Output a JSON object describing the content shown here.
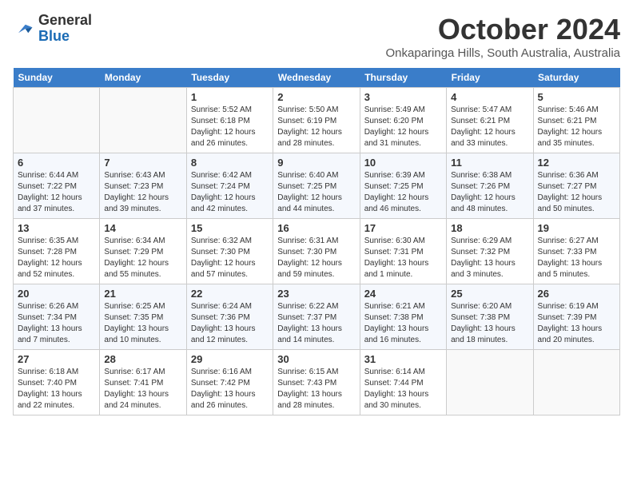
{
  "header": {
    "logo_general": "General",
    "logo_blue": "Blue",
    "month": "October 2024",
    "location": "Onkaparinga Hills, South Australia, Australia"
  },
  "days_of_week": [
    "Sunday",
    "Monday",
    "Tuesday",
    "Wednesday",
    "Thursday",
    "Friday",
    "Saturday"
  ],
  "weeks": [
    [
      {
        "num": "",
        "info": ""
      },
      {
        "num": "",
        "info": ""
      },
      {
        "num": "1",
        "info": "Sunrise: 5:52 AM\nSunset: 6:18 PM\nDaylight: 12 hours and 26 minutes."
      },
      {
        "num": "2",
        "info": "Sunrise: 5:50 AM\nSunset: 6:19 PM\nDaylight: 12 hours and 28 minutes."
      },
      {
        "num": "3",
        "info": "Sunrise: 5:49 AM\nSunset: 6:20 PM\nDaylight: 12 hours and 31 minutes."
      },
      {
        "num": "4",
        "info": "Sunrise: 5:47 AM\nSunset: 6:21 PM\nDaylight: 12 hours and 33 minutes."
      },
      {
        "num": "5",
        "info": "Sunrise: 5:46 AM\nSunset: 6:21 PM\nDaylight: 12 hours and 35 minutes."
      }
    ],
    [
      {
        "num": "6",
        "info": "Sunrise: 6:44 AM\nSunset: 7:22 PM\nDaylight: 12 hours and 37 minutes."
      },
      {
        "num": "7",
        "info": "Sunrise: 6:43 AM\nSunset: 7:23 PM\nDaylight: 12 hours and 39 minutes."
      },
      {
        "num": "8",
        "info": "Sunrise: 6:42 AM\nSunset: 7:24 PM\nDaylight: 12 hours and 42 minutes."
      },
      {
        "num": "9",
        "info": "Sunrise: 6:40 AM\nSunset: 7:25 PM\nDaylight: 12 hours and 44 minutes."
      },
      {
        "num": "10",
        "info": "Sunrise: 6:39 AM\nSunset: 7:25 PM\nDaylight: 12 hours and 46 minutes."
      },
      {
        "num": "11",
        "info": "Sunrise: 6:38 AM\nSunset: 7:26 PM\nDaylight: 12 hours and 48 minutes."
      },
      {
        "num": "12",
        "info": "Sunrise: 6:36 AM\nSunset: 7:27 PM\nDaylight: 12 hours and 50 minutes."
      }
    ],
    [
      {
        "num": "13",
        "info": "Sunrise: 6:35 AM\nSunset: 7:28 PM\nDaylight: 12 hours and 52 minutes."
      },
      {
        "num": "14",
        "info": "Sunrise: 6:34 AM\nSunset: 7:29 PM\nDaylight: 12 hours and 55 minutes."
      },
      {
        "num": "15",
        "info": "Sunrise: 6:32 AM\nSunset: 7:30 PM\nDaylight: 12 hours and 57 minutes."
      },
      {
        "num": "16",
        "info": "Sunrise: 6:31 AM\nSunset: 7:30 PM\nDaylight: 12 hours and 59 minutes."
      },
      {
        "num": "17",
        "info": "Sunrise: 6:30 AM\nSunset: 7:31 PM\nDaylight: 13 hours and 1 minute."
      },
      {
        "num": "18",
        "info": "Sunrise: 6:29 AM\nSunset: 7:32 PM\nDaylight: 13 hours and 3 minutes."
      },
      {
        "num": "19",
        "info": "Sunrise: 6:27 AM\nSunset: 7:33 PM\nDaylight: 13 hours and 5 minutes."
      }
    ],
    [
      {
        "num": "20",
        "info": "Sunrise: 6:26 AM\nSunset: 7:34 PM\nDaylight: 13 hours and 7 minutes."
      },
      {
        "num": "21",
        "info": "Sunrise: 6:25 AM\nSunset: 7:35 PM\nDaylight: 13 hours and 10 minutes."
      },
      {
        "num": "22",
        "info": "Sunrise: 6:24 AM\nSunset: 7:36 PM\nDaylight: 13 hours and 12 minutes."
      },
      {
        "num": "23",
        "info": "Sunrise: 6:22 AM\nSunset: 7:37 PM\nDaylight: 13 hours and 14 minutes."
      },
      {
        "num": "24",
        "info": "Sunrise: 6:21 AM\nSunset: 7:38 PM\nDaylight: 13 hours and 16 minutes."
      },
      {
        "num": "25",
        "info": "Sunrise: 6:20 AM\nSunset: 7:38 PM\nDaylight: 13 hours and 18 minutes."
      },
      {
        "num": "26",
        "info": "Sunrise: 6:19 AM\nSunset: 7:39 PM\nDaylight: 13 hours and 20 minutes."
      }
    ],
    [
      {
        "num": "27",
        "info": "Sunrise: 6:18 AM\nSunset: 7:40 PM\nDaylight: 13 hours and 22 minutes."
      },
      {
        "num": "28",
        "info": "Sunrise: 6:17 AM\nSunset: 7:41 PM\nDaylight: 13 hours and 24 minutes."
      },
      {
        "num": "29",
        "info": "Sunrise: 6:16 AM\nSunset: 7:42 PM\nDaylight: 13 hours and 26 minutes."
      },
      {
        "num": "30",
        "info": "Sunrise: 6:15 AM\nSunset: 7:43 PM\nDaylight: 13 hours and 28 minutes."
      },
      {
        "num": "31",
        "info": "Sunrise: 6:14 AM\nSunset: 7:44 PM\nDaylight: 13 hours and 30 minutes."
      },
      {
        "num": "",
        "info": ""
      },
      {
        "num": "",
        "info": ""
      }
    ]
  ]
}
